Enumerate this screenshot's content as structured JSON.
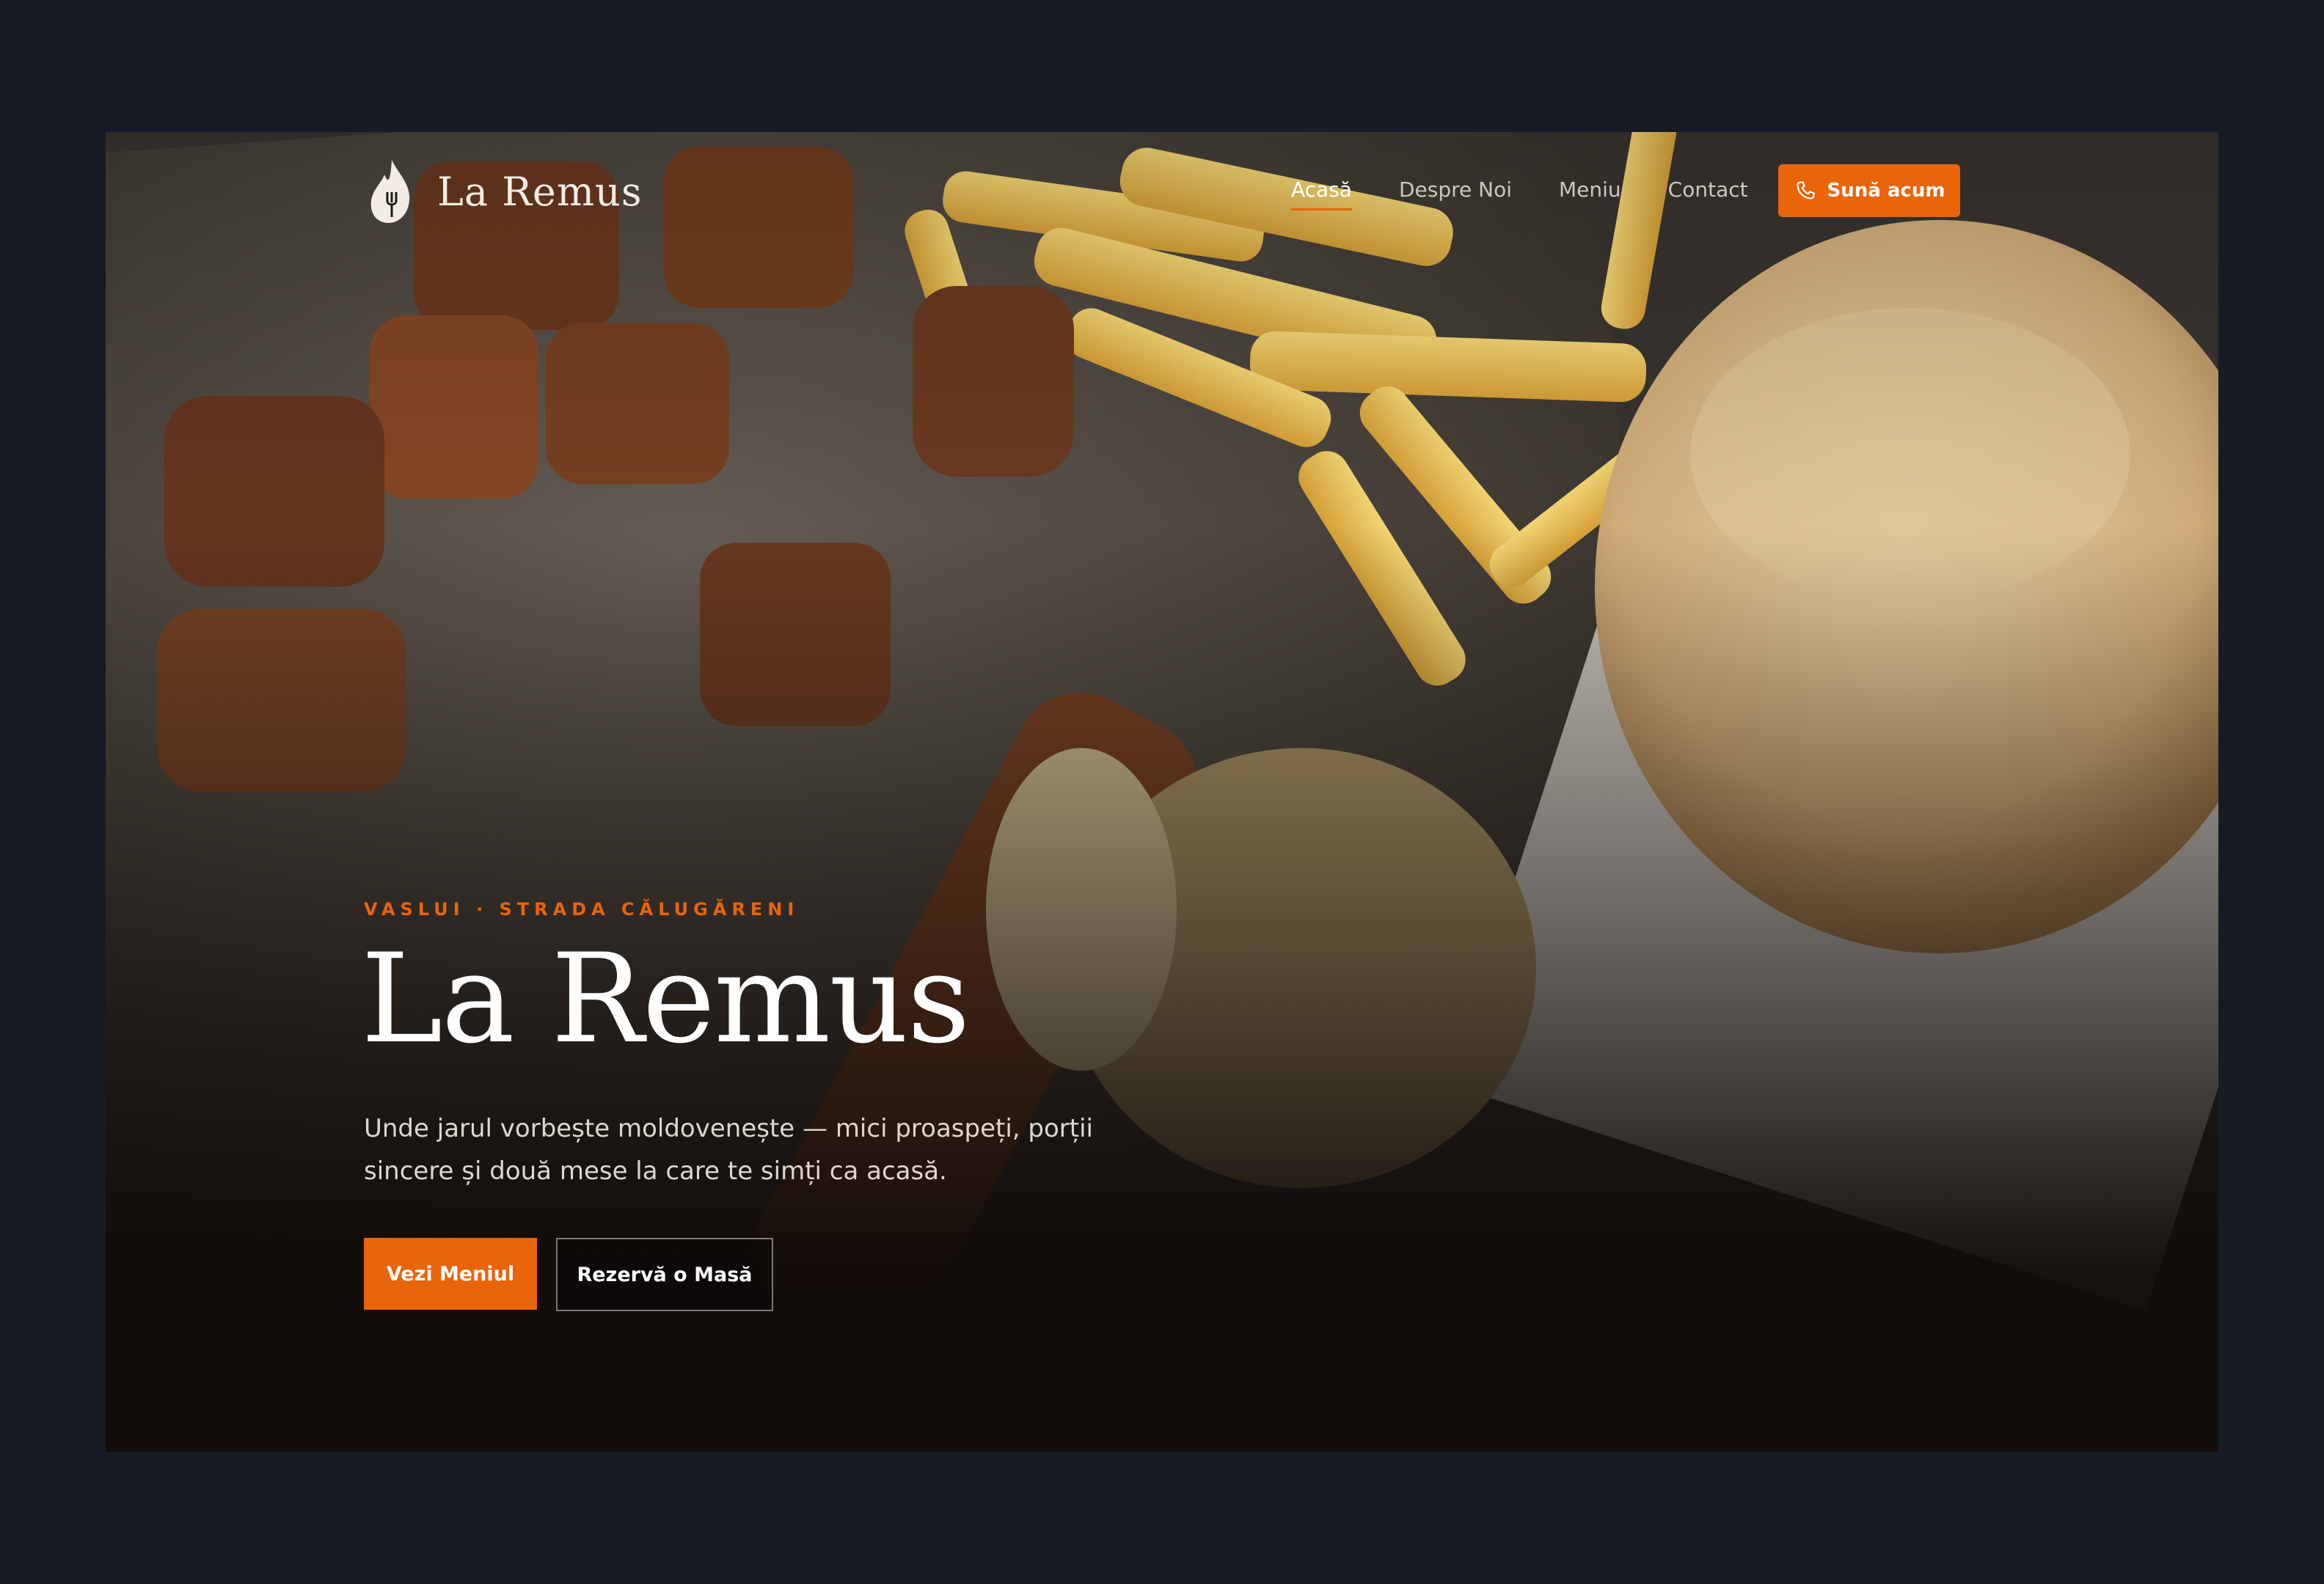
{
  "brand": {
    "name": "La Remus",
    "logo_icon": "flame-fork-icon"
  },
  "nav": {
    "items": [
      {
        "label": "Acasă",
        "active": true
      },
      {
        "label": "Despre Noi",
        "active": false
      },
      {
        "label": "Meniu",
        "active": false
      },
      {
        "label": "Contact",
        "active": false
      }
    ],
    "call_button": {
      "label": "Sună acum",
      "icon": "phone-icon"
    }
  },
  "hero": {
    "eyebrow": "VASLUI · STRADA CĂLUGĂRENI",
    "title": "La Remus",
    "description": "Unde jarul vorbește moldovenește — mici proaspeți, porții sincere și două mese la care te simți ca acasă.",
    "primary_button": "Vezi Meniul",
    "secondary_button": "Rezervă o Masă",
    "background_image": "grilled-mici-fries-bread-photo"
  },
  "colors": {
    "accent": "#e8650a",
    "page_background": "#161b25",
    "text_primary": "#ffffff"
  }
}
